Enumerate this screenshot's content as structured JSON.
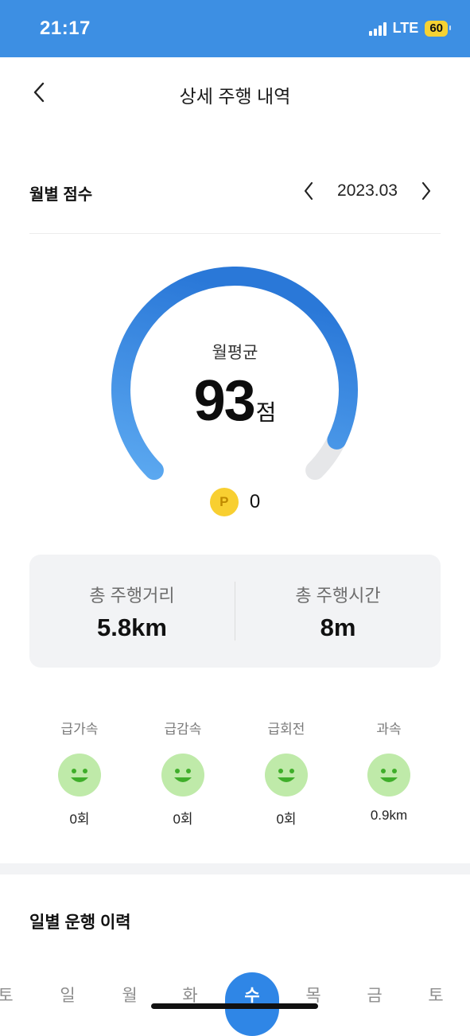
{
  "status_bar": {
    "time": "21:17",
    "network": "LTE",
    "battery": "60",
    "background_color": "#3d8fe3"
  },
  "header": {
    "title": "상세 주행 내역",
    "back_icon": "chevron-left-icon"
  },
  "monthly_score": {
    "label": "월별 점수",
    "month": "2023.03",
    "prev_icon": "chevron-left-icon",
    "next_icon": "chevron-right-icon"
  },
  "gauge": {
    "label": "월평균",
    "score": "93",
    "unit": "점",
    "score_fraction": 0.93,
    "arc_color_start": "#5ba8f0",
    "arc_color_end": "#2a78d8",
    "track_color": "#e6e7e9"
  },
  "points": {
    "icon_letter": "P",
    "value": "0"
  },
  "summary": {
    "distance_label": "총 주행거리",
    "distance_value": "5.8km",
    "time_label": "총 주행시간",
    "time_value": "8m"
  },
  "metrics": [
    {
      "label": "급가속",
      "value": "0회",
      "icon": "smiley-icon"
    },
    {
      "label": "급감속",
      "value": "0회",
      "icon": "smiley-icon"
    },
    {
      "label": "급회전",
      "value": "0회",
      "icon": "smiley-icon"
    },
    {
      "label": "과속",
      "value": "0.9km",
      "icon": "smiley-icon"
    }
  ],
  "daily_history": {
    "title": "일별 운행 이력"
  },
  "days": [
    "토",
    "일",
    "월",
    "화",
    "수",
    "목",
    "금",
    "토"
  ],
  "selected_day": "수",
  "accent_color": "#2f86e6"
}
